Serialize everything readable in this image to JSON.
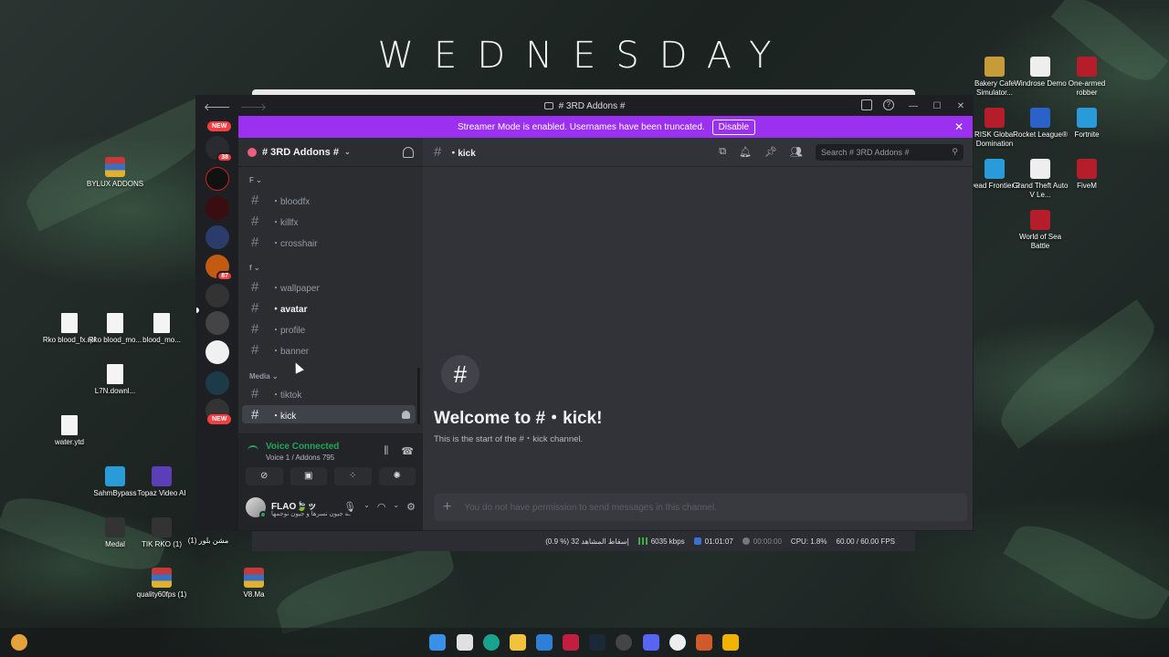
{
  "wallpaper": {
    "title": "WEDNESDAY"
  },
  "desktop_icons": [
    {
      "id": "bylux",
      "label": "BYLUX ADDONS",
      "icon": "winrar-icon"
    },
    {
      "id": "rko-fx",
      "label": "Rko blood_fx.rpf",
      "icon": "file-icon"
    },
    {
      "id": "rko-mo",
      "label": "Rko blood_mo...",
      "icon": "file-icon"
    },
    {
      "id": "blood-mo",
      "label": "blood_mo...",
      "icon": "file-icon"
    },
    {
      "id": "l7n",
      "label": "L7N.downl...",
      "icon": "file-icon"
    },
    {
      "id": "water",
      "label": "water.ytd",
      "icon": "file-icon"
    },
    {
      "id": "sahm",
      "label": "SahmBypass",
      "icon": "app-icon"
    },
    {
      "id": "topaz",
      "label": "Topaz Video AI",
      "icon": "topaz-icon"
    },
    {
      "id": "medal",
      "label": "Medal",
      "icon": "medal-icon"
    },
    {
      "id": "tikrko",
      "label": "TIK RKO (1)",
      "icon": "image-icon"
    },
    {
      "id": "mshn",
      "label": "مشن بلور (1)",
      "icon": "none"
    },
    {
      "id": "quality",
      "label": "quality60fps (1)",
      "icon": "winrar-icon"
    },
    {
      "id": "v8",
      "label": "V8.Ma",
      "icon": "winrar-icon"
    },
    {
      "id": "bakery",
      "label": "Bakery Cafe Simulator...",
      "icon": "game-icon"
    },
    {
      "id": "windrose",
      "label": "Windrose Demo",
      "icon": "game-icon"
    },
    {
      "id": "onearmed",
      "label": "One-armed robber",
      "icon": "game-icon"
    },
    {
      "id": "risk",
      "label": "RISK Global Domination",
      "icon": "game-icon"
    },
    {
      "id": "rocket",
      "label": "Rocket League®",
      "icon": "game-icon"
    },
    {
      "id": "fortnite",
      "label": "Fortnite",
      "icon": "game-icon"
    },
    {
      "id": "deadfrontier",
      "label": "Dead Frontier 2",
      "icon": "game-icon"
    },
    {
      "id": "gta",
      "label": "Grand Theft Auto V Le...",
      "icon": "game-icon"
    },
    {
      "id": "fivem",
      "label": "FiveM",
      "icon": "game-icon"
    },
    {
      "id": "worldsea",
      "label": "World of Sea Battle",
      "icon": "game-icon"
    }
  ],
  "discord": {
    "window_title": "# 3RD Addons #",
    "streamer_notice": "Streamer Mode is enabled. Usernames have been truncated.",
    "disable_label": "Disable",
    "server_badges": {
      "top": "NEW",
      "badge1": "38",
      "badge2": "87",
      "bottom": "NEW"
    },
    "guild_name": "# 3RD Addons #",
    "categories": [
      {
        "label": "F"
      },
      {
        "label": "f"
      },
      {
        "label": "Media"
      }
    ],
    "channels": [
      {
        "name": "・bloodfx"
      },
      {
        "name": "・killfx"
      },
      {
        "name": "・crosshair"
      },
      {
        "name": "・wallpaper"
      },
      {
        "name": "・avatar"
      },
      {
        "name": "・profile"
      },
      {
        "name": "・banner"
      },
      {
        "name": "・tiktok"
      },
      {
        "name": "・kick"
      }
    ],
    "voice": {
      "title": "Voice Connected",
      "subtitle": "Voice 1 / Addons 795"
    },
    "user": {
      "name": "FLAO🍃ッ",
      "status": "ـه جيون نسرها و جيون نوجمها"
    },
    "header": {
      "channel": "・kick",
      "search_placeholder": "Search # 3RD Addons #"
    },
    "welcome_title": "Welcome to #・kick!",
    "welcome_subtitle": "This is the start of the #・kick channel.",
    "composer_placeholder": "You do not have permission to send messages in this channel."
  },
  "obs_status": {
    "dropped": "(0.9 %) 32 إسقاط المشاهد",
    "bitrate": "6035 kbps",
    "live_time": "01:01:07",
    "rec_time": "00:00:00",
    "cpu": "CPU: 1.8%",
    "fps": "60.00 / 60.00 FPS"
  },
  "colors": {
    "notice_bg": "#9b30f0",
    "voice_green": "#23a55a",
    "badge_red": "#f23f43"
  }
}
